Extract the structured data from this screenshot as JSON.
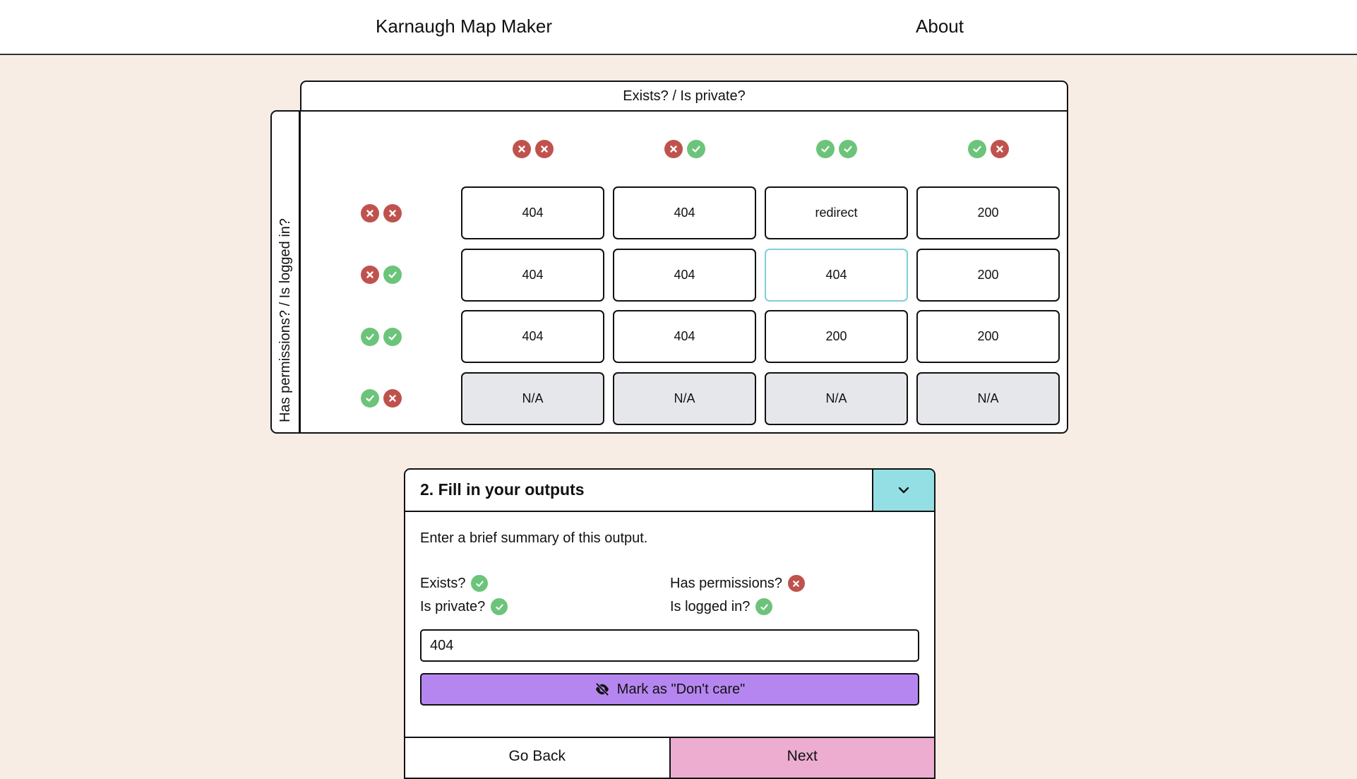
{
  "nav": {
    "title": "Karnaugh Map Maker",
    "about": "About"
  },
  "map": {
    "column_axis_label": "Exists? / Is private?",
    "row_axis_label": "Has permissions? / Is logged in?",
    "columns": [
      {
        "values": [
          false,
          false
        ]
      },
      {
        "values": [
          false,
          true
        ]
      },
      {
        "values": [
          true,
          true
        ]
      },
      {
        "values": [
          true,
          false
        ]
      }
    ],
    "rows": [
      {
        "values": [
          false,
          false
        ],
        "cells": [
          "404",
          "404",
          "redirect",
          "200"
        ]
      },
      {
        "values": [
          false,
          true
        ],
        "cells": [
          "404",
          "404",
          "404",
          "200"
        ]
      },
      {
        "values": [
          true,
          true
        ],
        "cells": [
          "404",
          "404",
          "200",
          "200"
        ]
      },
      {
        "values": [
          true,
          false
        ],
        "cells": [
          "N/A",
          "N/A",
          "N/A",
          "N/A"
        ]
      }
    ],
    "na_label": "N/A",
    "selected_cell": {
      "row": 1,
      "col": 2
    }
  },
  "panel": {
    "title": "2. Fill in your outputs",
    "toggle_icon": "chevron-down-icon",
    "description": "Enter a brief summary of this output.",
    "attributes": [
      {
        "label": "Exists?",
        "value": true
      },
      {
        "label": "Is private?",
        "value": true
      },
      {
        "label": "Has permissions?",
        "value": false
      },
      {
        "label": "Is logged in?",
        "value": true
      }
    ],
    "summary_value": "404",
    "dont_care_label": "Mark as \"Don't care\"",
    "dont_care_icon": "eye-slash-icon",
    "back_label": "Go Back",
    "next_label": "Next"
  },
  "colors": {
    "background": "#f7ede4",
    "true_green": "#6cc47a",
    "false_red": "#c0524e",
    "accent_teal": "#94dfe4",
    "selected_border": "#7fcfd8",
    "dont_care_purple": "#b686f0",
    "next_pink": "#ecadd0",
    "na_gray": "#e6e7ea"
  }
}
